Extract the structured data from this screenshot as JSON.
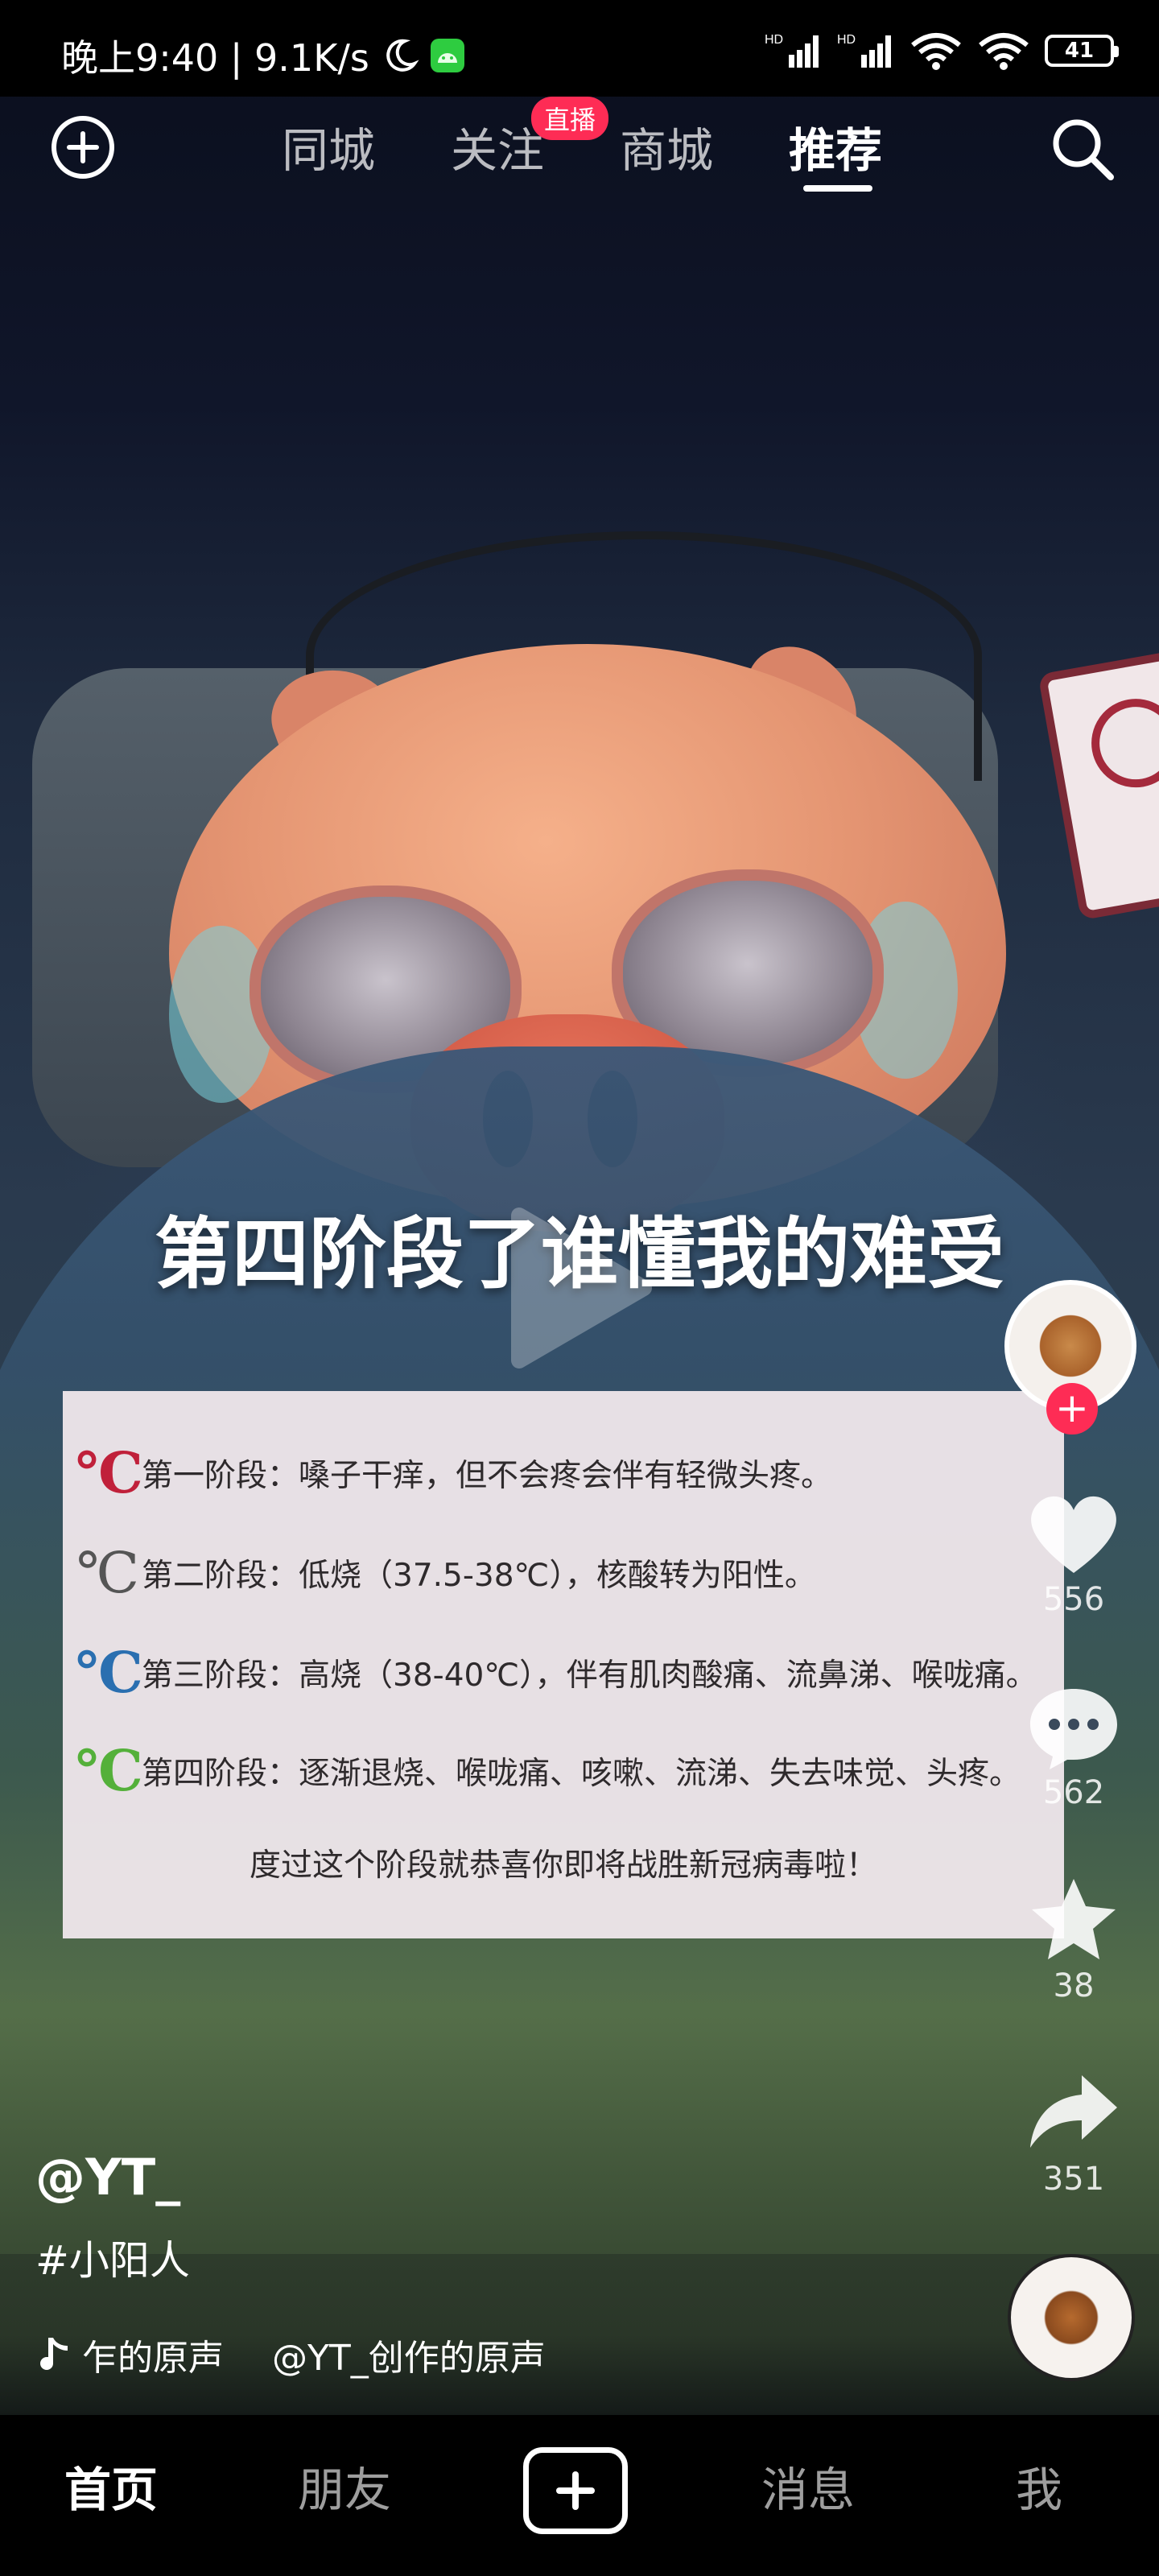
{
  "status_bar": {
    "time_and_speed": "晚上9:40 | 9.1K/s",
    "battery": "41",
    "signal_label_1": "HD",
    "signal_label_2": "HD"
  },
  "top_nav": {
    "tabs": [
      {
        "label": "同城"
      },
      {
        "label": "关注"
      },
      {
        "label": "商城"
      },
      {
        "label": "推荐"
      }
    ],
    "live_badge": "直播",
    "active_tab": "推荐"
  },
  "video": {
    "caption": "第四阶段了谁懂我的难受",
    "info_card": {
      "stages": [
        {
          "icon": "℃",
          "color": "#c0203a",
          "label": "第一阶段：",
          "text": "嗓子干痒，但不会疼会伴有轻微头疼。"
        },
        {
          "icon": "℃",
          "color": "#555555",
          "label": "第二阶段：",
          "text": "低烧（37.5-38℃），核酸转为阳性。"
        },
        {
          "icon": "℃",
          "color": "#2a6fb0",
          "label": "第三阶段：",
          "text": "高烧（38-40℃），伴有肌肉酸痛、流鼻涕、喉咙痛。"
        },
        {
          "icon": "℃",
          "color": "#54b03a",
          "label": "第四阶段：",
          "text": "逐渐退烧、喉咙痛、咳嗽、流涕、失去味觉、头疼。"
        }
      ],
      "footer": "度过这个阶段就恭喜你即将战胜新冠病毒啦！"
    }
  },
  "actions": {
    "follow_symbol": "+",
    "likes": "556",
    "comments": "562",
    "favorites": "38",
    "shares": "351"
  },
  "post": {
    "author": "@YT_",
    "hashtag": "#小阳人",
    "music_text_1": "乍的原声",
    "music_text_2": "@YT_创作的原声"
  },
  "bottom_nav": {
    "home": "首页",
    "friends": "朋友",
    "messages": "消息",
    "me": "我"
  },
  "colors": {
    "accent": "#fe2c55",
    "background": "#000000"
  },
  "icons": [
    "add-circle-icon",
    "search-icon",
    "heart-icon",
    "comment-icon",
    "star-icon",
    "share-icon",
    "music-note-icon",
    "moon-icon",
    "wifi-icon",
    "battery-icon",
    "plus-icon"
  ]
}
